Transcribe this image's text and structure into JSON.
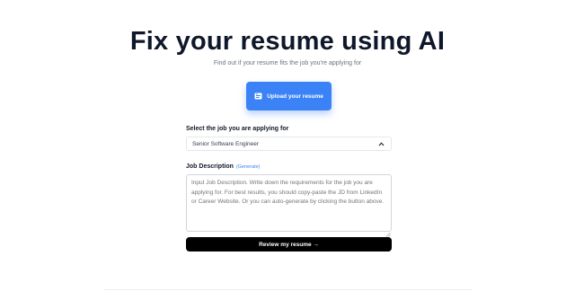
{
  "header": {
    "title": "Fix your resume using AI",
    "subtitle": "Find out if your resume fits the job you're applying for"
  },
  "upload": {
    "label": "Upload your resume",
    "icon": "file-upload-icon",
    "color": "#3b82f6"
  },
  "job_select": {
    "label": "Select the job you are applying for",
    "selected": "Senior Software Engineer",
    "icon": "chevron-up-icon"
  },
  "job_description": {
    "label": "Job Description",
    "generate_link": "(Generate)",
    "placeholder": "Input Job Description. Write down the requirements for the job you are applying for. For best results, you should copy-paste the JD from LinkedIn or Career Website. Or you can auto-generate by clicking the button above."
  },
  "review": {
    "label": "Review my resume →",
    "color": "#000000"
  }
}
